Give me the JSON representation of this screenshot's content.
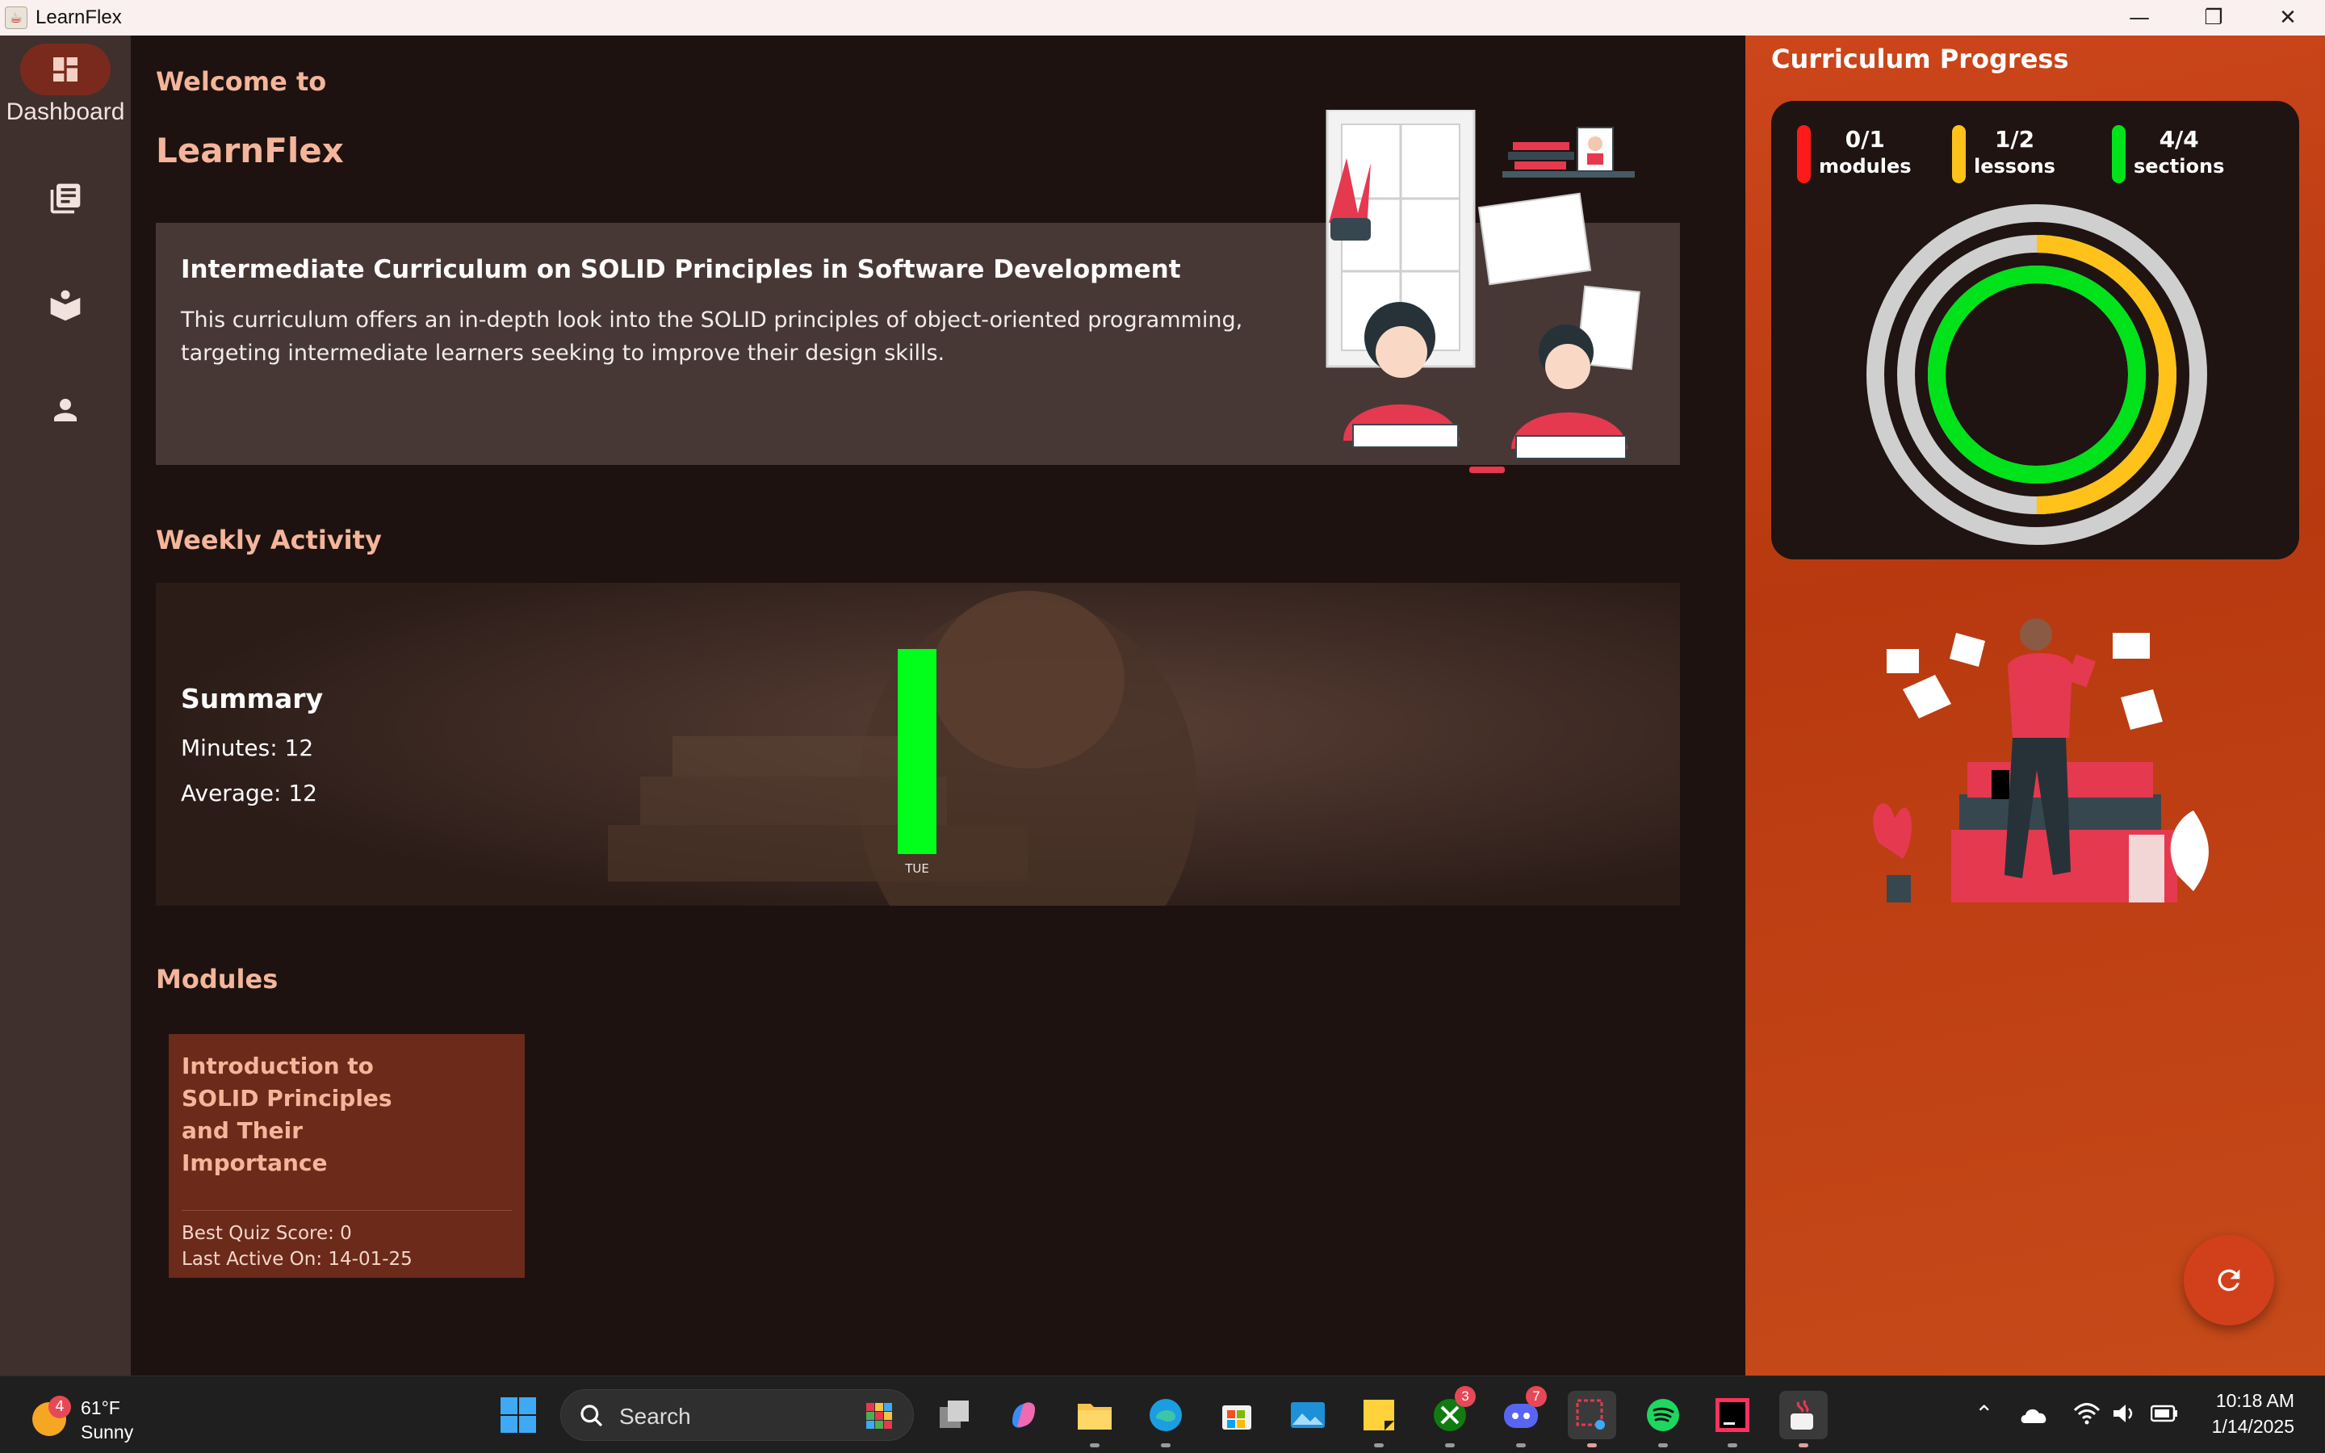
{
  "window": {
    "title": "LearnFlex",
    "minimize": "—",
    "maximize": "❐",
    "close": "✕"
  },
  "sidebar": {
    "items": [
      {
        "label": "Dashboard",
        "icon": "dashboard-icon",
        "active": true
      },
      {
        "label": "",
        "icon": "library-icon"
      },
      {
        "label": "",
        "icon": "open-book-icon"
      },
      {
        "label": "",
        "icon": "person-icon"
      }
    ]
  },
  "header": {
    "welcome": "Welcome to",
    "brand": "LearnFlex"
  },
  "curriculum": {
    "title": "Intermediate Curriculum on SOLID Principles in Software Development",
    "description": "This curriculum offers an in-depth look into the SOLID principles of object-oriented programming, targeting intermediate learners seeking to improve their design skills."
  },
  "weekly_activity": {
    "heading": "Weekly Activity",
    "summary_title": "Summary",
    "minutes": "Minutes: 12",
    "average": "Average: 12",
    "bars": [
      {
        "day": "TUE",
        "minutes": 12,
        "color": "#00ff1a"
      }
    ]
  },
  "modules": {
    "heading": "Modules",
    "items": [
      {
        "title": "Introduction to SOLID Principles and Their Importance",
        "best_quiz_score": "Best Quiz Score: 0",
        "last_active": "Last Active On:  14-01-25"
      }
    ]
  },
  "progress": {
    "title": "Curriculum Progress",
    "stats": [
      {
        "value": "0/1",
        "label": "modules",
        "color": "#ff1a1a",
        "fraction": 0.0
      },
      {
        "value": "1/2",
        "label": "lessons",
        "color": "#ffc21a",
        "fraction": 0.5
      },
      {
        "value": "4/4",
        "label": "sections",
        "color": "#00e21a",
        "fraction": 1.0
      }
    ],
    "track_color": "#cfcfcf"
  },
  "refresh_icon": "refresh-icon",
  "taskbar": {
    "weather": {
      "badge": "4",
      "temp": "61°F",
      "condition": "Sunny"
    },
    "search_placeholder": "Search",
    "apps": [
      {
        "name": "task-view-icon"
      },
      {
        "name": "copilot-icon"
      },
      {
        "name": "file-explorer-icon"
      },
      {
        "name": "edge-icon"
      },
      {
        "name": "store-icon"
      },
      {
        "name": "photos-icon"
      },
      {
        "name": "sticky-notes-icon"
      },
      {
        "name": "xbox-icon",
        "badge": "3"
      },
      {
        "name": "discord-icon",
        "badge": "7"
      },
      {
        "name": "snipping-tool-icon"
      },
      {
        "name": "spotify-icon"
      },
      {
        "name": "intellij-icon"
      },
      {
        "name": "java-icon"
      }
    ],
    "time": "10:18 AM",
    "date": "1/14/2025"
  }
}
